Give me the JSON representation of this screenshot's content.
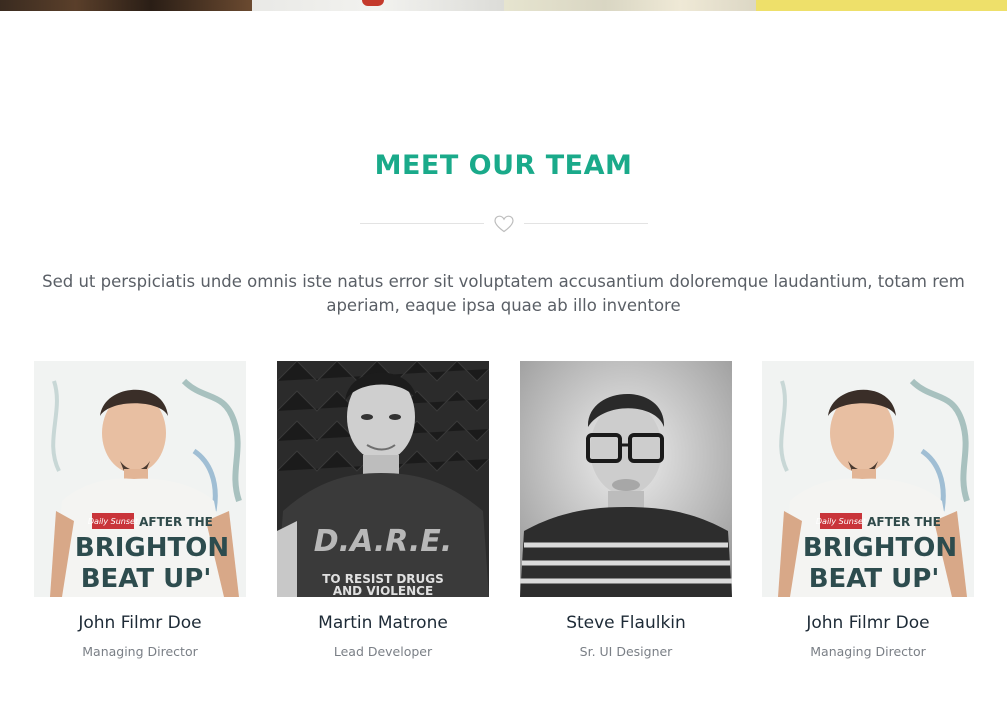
{
  "banner": {
    "segments": [
      "dark-photo",
      "white-photo",
      "pale-photo",
      "yellow-photo"
    ]
  },
  "section": {
    "title": "MEET OUR TEAM",
    "divider_icon": "heart-icon",
    "intro": "Sed ut perspiciatis unde omnis iste natus error sit voluptatem accusantium doloremque laudantium, totam rem aperiam, eaque ipsa quae ab illo inventore"
  },
  "team": [
    {
      "name": "John Filmr Doe",
      "role": "Managing Director",
      "shirt_text": [
        "Daily Sunset",
        "AFTER THE",
        "BRIGHTON",
        "BEAT UP'"
      ]
    },
    {
      "name": "Martin Matrone",
      "role": "Lead Developer",
      "shirt_text": [
        "D.A.R.E.",
        "TO RESIST DRUGS",
        "AND VIOLENCE"
      ]
    },
    {
      "name": "Steve Flaulkin",
      "role": "Sr. UI Designer",
      "shirt_text": []
    },
    {
      "name": "John Filmr Doe",
      "role": "Managing Director",
      "shirt_text": [
        "Daily Sunset",
        "AFTER THE",
        "BRIGHTON",
        "BEAT UP'"
      ]
    }
  ],
  "colors": {
    "accent": "#1aaa8a",
    "text": "#5a5f66",
    "name": "#1d2a36",
    "role": "#7a7f86"
  }
}
